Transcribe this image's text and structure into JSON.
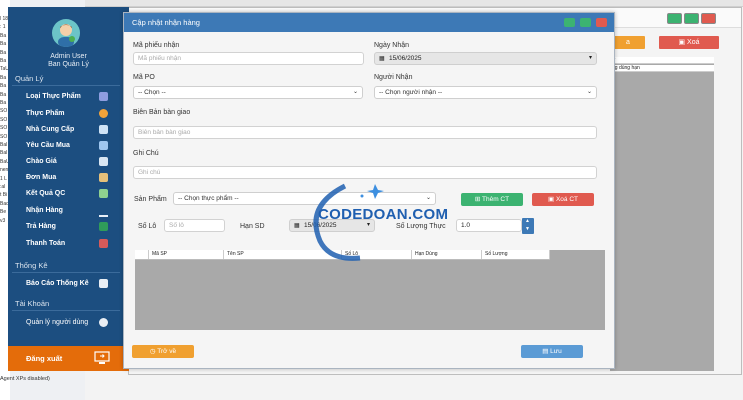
{
  "background": {
    "left_panel_items": [
      "l 18",
      ": 1",
      "Ba",
      "Ba",
      "Ba",
      "Ba",
      "TaU",
      "Ba",
      "Ba",
      "Ba",
      "Ba",
      "SO",
      "SO",
      "SO",
      "SO",
      "Bal",
      "Bal",
      "BaU",
      "nen",
      "1 L",
      ":al",
      "t Bi",
      "Bac",
      "Be",
      "v3"
    ],
    "bottom_status": "Agent XPs disabled)",
    "buttons": {
      "orange_label": "a",
      "delete_label": "Xoá"
    },
    "grid_rows": [
      "ớ",
      "ng dùng hạn"
    ]
  },
  "sidebar": {
    "user_name": "Admin User",
    "role": "Ban Quản Lý",
    "sections": [
      {
        "title": "Quản Lý",
        "items": [
          {
            "label": "Loại Thực Phẩm",
            "icon": "grid-icon",
            "color": "#8e9de0"
          },
          {
            "label": "Thực Phẩm",
            "icon": "food-icon",
            "color": "#f2a33a"
          },
          {
            "label": "Nhà Cung Cấp",
            "icon": "truck-icon",
            "color": "#cfe3f5"
          },
          {
            "label": "Yêu Cầu Mua",
            "icon": "cart-icon",
            "color": "#9ec6ef"
          },
          {
            "label": "Chào Giá",
            "icon": "document-icon",
            "color": "#d9e6f2"
          },
          {
            "label": "Đơn Mua",
            "icon": "box-icon",
            "color": "#e5c07a"
          },
          {
            "label": "Kết Quả QC",
            "icon": "flask-icon",
            "color": "#8fd18f"
          },
          {
            "label": "Nhận Hàng",
            "icon": "download-icon",
            "color": "#e6eef7"
          },
          {
            "label": "Trả Hàng",
            "icon": "return-icon",
            "color": "#2f9c5a"
          },
          {
            "label": "Thanh Toán",
            "icon": "payment-icon",
            "color": "#d65a5a"
          }
        ]
      },
      {
        "title": "Thống Kê",
        "items": [
          {
            "label": "Báo Cáo Thống Kê",
            "icon": "report-icon",
            "color": "#e9eef4"
          }
        ]
      },
      {
        "title": "Tài Khoản",
        "items": [
          {
            "label": "Quản lý người dùng",
            "icon": "users-icon",
            "color": "#e9eef4"
          }
        ]
      }
    ],
    "logout_label": "Đăng xuất"
  },
  "dialog": {
    "title": "Cập nhật nhận hàng",
    "fields": {
      "receipt_code": {
        "label": "Mã phiếu nhận",
        "placeholder": "Mã phiếu nhận"
      },
      "receive_date": {
        "label": "Ngày Nhận",
        "value": "15/06/2025"
      },
      "po_code": {
        "label": "Mã PO",
        "value": "-- Chọn --"
      },
      "receiver": {
        "label": "Người Nhận",
        "value": "-- Chọn người nhận --"
      },
      "handover": {
        "label": "Biên Bản bàn giao",
        "placeholder": "Biên bản bàn giao"
      },
      "note": {
        "label": "Ghi Chú",
        "placeholder": "Ghi chú"
      },
      "product": {
        "label": "Sản Phẩm",
        "value": "-- Chọn thực phẩm --"
      },
      "lot": {
        "label": "Số Lô",
        "placeholder": "Số lô"
      },
      "expiry": {
        "label": "Hạn SD",
        "value": "15/06/2025"
      },
      "quantity": {
        "label": "Số Lượng Thực",
        "value": "1.0"
      }
    },
    "buttons": {
      "add_detail": "Thêm CT",
      "delete_detail": "Xoá CT",
      "back": "Trở về",
      "save": "Lưu"
    },
    "grid_columns": [
      "Mã SP",
      "Tên SP",
      "Số Lô",
      "Hạn Dùng",
      "Số Lượng"
    ]
  },
  "watermark": {
    "text": "CODEDOAN.COM"
  },
  "colors": {
    "sidebar": "#1c4e80",
    "dialog_title": "#3d79b6",
    "green": "#3cb371",
    "red": "#e05a4f",
    "orange": "#f0a030",
    "blue": "#5b9bd5",
    "logout": "#e46c0a"
  }
}
